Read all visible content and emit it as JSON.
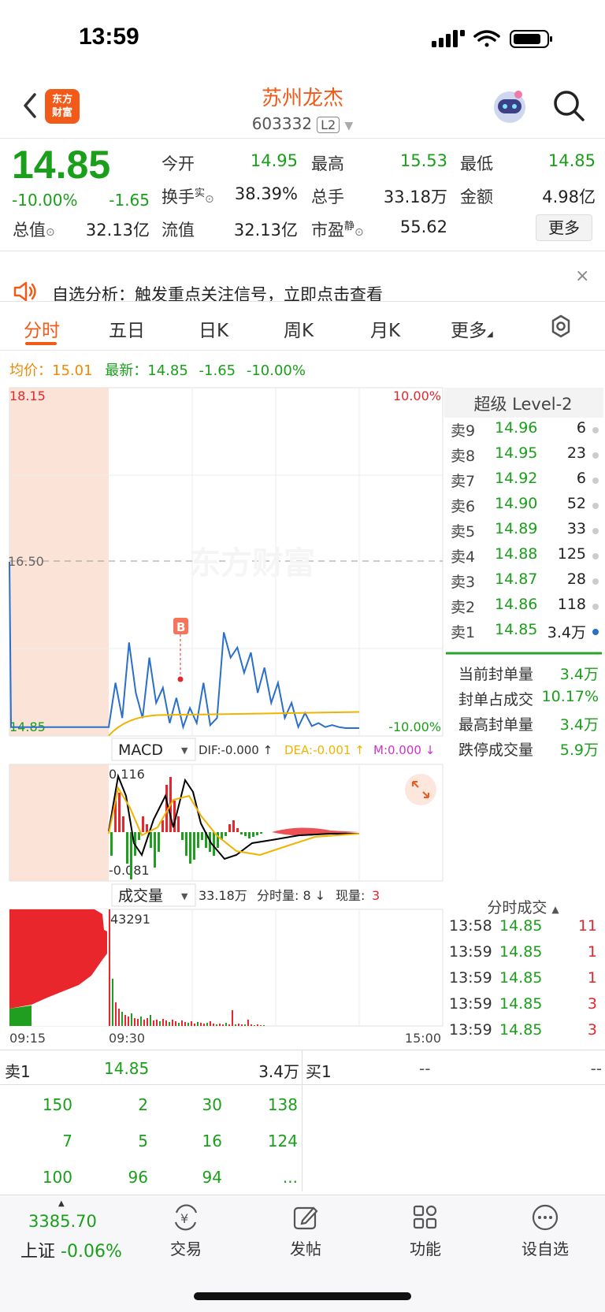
{
  "status": {
    "time": "13:59"
  },
  "header": {
    "logo_line1": "东方",
    "logo_line2": "财富",
    "stock_name": "苏州龙杰",
    "stock_code": "603332",
    "level_badge": "L2"
  },
  "quote": {
    "price": "14.85",
    "pct": "-10.00%",
    "change": "-1.65",
    "rows": [
      [
        {
          "label": "今开",
          "value": "14.95",
          "color": "green"
        },
        {
          "label": "最高",
          "value": "15.53",
          "color": "green"
        },
        {
          "label": "最低",
          "value": "14.85",
          "color": "green"
        }
      ],
      [
        {
          "label": "换手",
          "value": "38.39%",
          "color": "black",
          "sup": "实"
        },
        {
          "label": "总手",
          "value": "33.18万",
          "color": "black"
        },
        {
          "label": "金额",
          "value": "4.98亿",
          "color": "black"
        }
      ],
      [
        {
          "label": "总值",
          "value": "32.13亿",
          "color": "black"
        },
        {
          "label": "流值",
          "value": "32.13亿",
          "color": "black"
        },
        {
          "label": "市盈",
          "value": "55.62",
          "color": "black",
          "sup": "静"
        }
      ]
    ],
    "more_label": "更多"
  },
  "notice": {
    "text": "自选分析：触发重点关注信号，立即点击查看",
    "close": "×"
  },
  "tabs": [
    "分时",
    "五日",
    "日K",
    "周K",
    "月K",
    "更多"
  ],
  "avg_bar": {
    "avg_label": "均价：",
    "avg_value": "15.01",
    "latest_label": "最新：",
    "latest_value": "14.85",
    "latest_change": "-1.65",
    "latest_pct": "-10.00%"
  },
  "chart_data": {
    "type": "line",
    "price_axis": {
      "top": "18.15",
      "mid": "16.50",
      "bottom": "14.85",
      "top_pct": "10.00%",
      "bottom_pct": "-10.00%"
    },
    "time_axis": [
      "09:15",
      "09:30",
      "15:00"
    ],
    "marker": "B",
    "watermark": "东方财富",
    "series": [
      {
        "name": "最新",
        "color": "#2a6fc9",
        "values": [
          16.5,
          14.86,
          14.86,
          15.3,
          14.95,
          15.7,
          15.2,
          14.95,
          15.55,
          15.1,
          15.25,
          14.9,
          15.15,
          14.86,
          15.05,
          14.9,
          15.3,
          14.88,
          14.95,
          15.8,
          15.55,
          15.65,
          15.4,
          15.6,
          15.2,
          15.45,
          15.1,
          15.3,
          14.95,
          15.1,
          14.86,
          15.0,
          14.87,
          14.9,
          14.86,
          14.88,
          14.86,
          14.85,
          14.85,
          14.85
        ]
      },
      {
        "name": "均价",
        "color": "#f0b400",
        "values": [
          15.01
        ]
      }
    ],
    "macd": {
      "label": "MACD",
      "dif": "DIF:-0.000 ↑",
      "dea": "DEA:-0.001 ↑",
      "m": "M:0.000 ↓",
      "top": "0.116",
      "bottom": "-0.081"
    },
    "volume": {
      "label": "成交量",
      "total": "33.18万",
      "per_minute": "分时量: 8 ↓",
      "current_label": "现量:",
      "current": "3",
      "top": "43291"
    }
  },
  "orderbook": {
    "title": "超级 Level-2",
    "asks": [
      {
        "label": "卖9",
        "price": "14.96",
        "vol": "6"
      },
      {
        "label": "卖8",
        "price": "14.95",
        "vol": "23"
      },
      {
        "label": "卖7",
        "price": "14.92",
        "vol": "6"
      },
      {
        "label": "卖6",
        "price": "14.90",
        "vol": "52"
      },
      {
        "label": "卖5",
        "price": "14.89",
        "vol": "33"
      },
      {
        "label": "卖4",
        "price": "14.88",
        "vol": "125"
      },
      {
        "label": "卖3",
        "price": "14.87",
        "vol": "28"
      },
      {
        "label": "卖2",
        "price": "14.86",
        "vol": "118"
      },
      {
        "label": "卖1",
        "price": "14.85",
        "vol": "3.4万"
      }
    ],
    "seal": [
      {
        "label": "当前封单量",
        "value": "3.4万"
      },
      {
        "label": "封单占成交",
        "value": "10.17%"
      },
      {
        "label": "最高封单量",
        "value": "3.4万"
      },
      {
        "label": "跌停成交量",
        "value": "5.9万"
      }
    ]
  },
  "trades": {
    "title": "分时成交",
    "rows": [
      {
        "time": "13:58",
        "price": "14.85",
        "vol": "11"
      },
      {
        "time": "13:59",
        "price": "14.85",
        "vol": "1"
      },
      {
        "time": "13:59",
        "price": "14.85",
        "vol": "1"
      },
      {
        "time": "13:59",
        "price": "14.85",
        "vol": "3"
      },
      {
        "time": "13:59",
        "price": "14.85",
        "vol": "3"
      }
    ]
  },
  "bidask": {
    "sell_label": "卖1",
    "sell_price": "14.85",
    "sell_vol": "3.4万",
    "buy_label": "买1",
    "buy_price": "--",
    "buy_vol": "--",
    "queue": [
      [
        "150",
        "2",
        "30",
        "138"
      ],
      [
        "7",
        "5",
        "16",
        "124"
      ],
      [
        "100",
        "96",
        "94",
        "..."
      ]
    ]
  },
  "bottom_nav": {
    "index_value": "3385.70",
    "index_name": "上证",
    "index_pct": "-0.06%",
    "items": [
      "交易",
      "发帖",
      "功能",
      "设自选"
    ]
  }
}
